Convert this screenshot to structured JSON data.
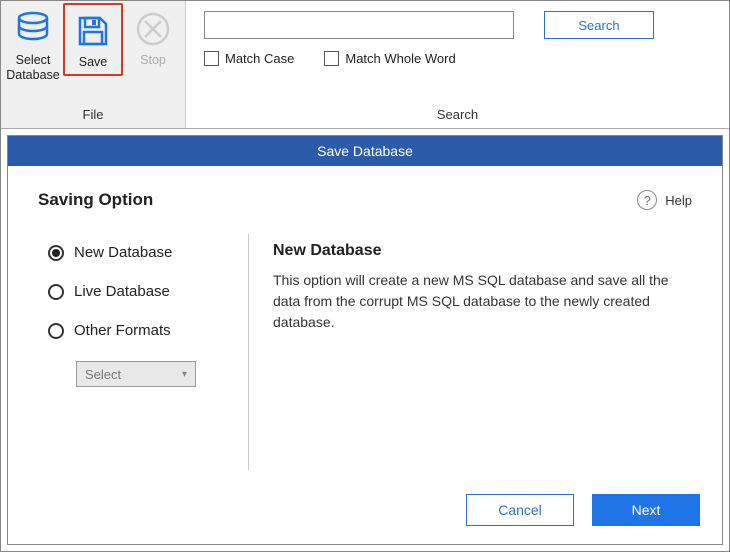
{
  "ribbon": {
    "file_group_label": "File",
    "select_db_label": "Select Database",
    "save_label": "Save",
    "stop_label": "Stop",
    "search_group_label": "Search",
    "search_button": "Search",
    "match_case": "Match Case",
    "match_whole_word": "Match Whole Word",
    "search_value": ""
  },
  "modal": {
    "title": "Save Database",
    "saving_option_heading": "Saving Option",
    "help_label": "Help",
    "options": {
      "new_db": "New Database",
      "live_db": "Live Database",
      "other_formats": "Other Formats"
    },
    "select_placeholder": "Select",
    "desc_title": "New Database",
    "desc_text": "This option will create a new MS SQL database and save all the data from the corrupt MS SQL database to the newly created database.",
    "cancel": "Cancel",
    "next": "Next"
  },
  "colors": {
    "accent": "#2c5ba9",
    "primary_btn": "#1f74e6",
    "highlight_border": "#d43a2a"
  }
}
